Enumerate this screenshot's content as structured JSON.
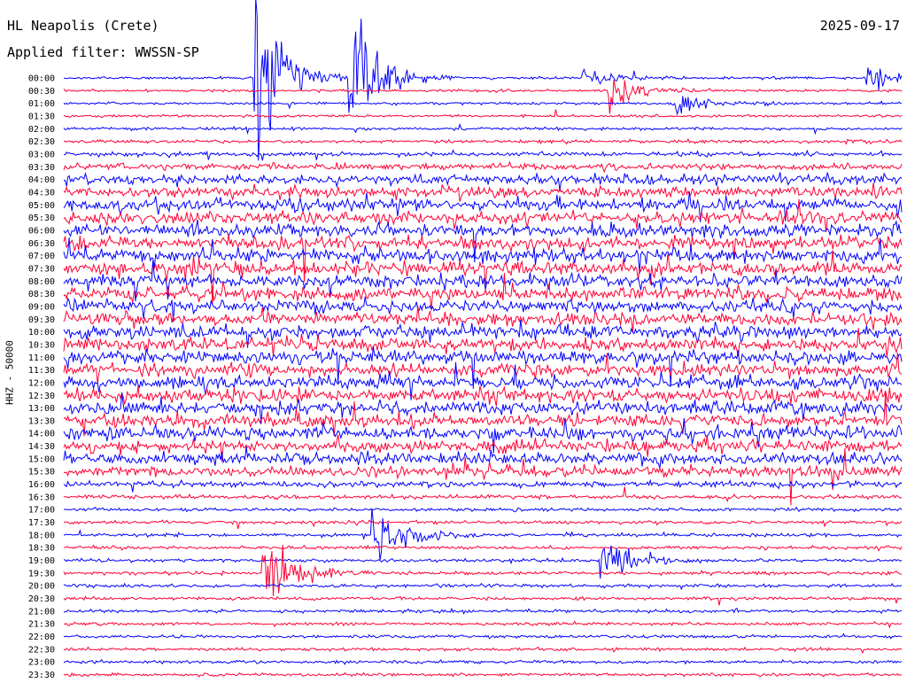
{
  "header": {
    "station": "HL Neapolis (Crete)",
    "filter": "Applied filter: WWSSN-SP",
    "date": "2025-09-17",
    "channel_label": "HHZ - 50000"
  },
  "chart_data": {
    "type": "line",
    "title": "HL Neapolis (Crete)",
    "subtitle": "Applied filter: WWSSN-SP",
    "date": "2025-09-17",
    "ylabel": "HHZ - 50000",
    "trace_colors": [
      "#0000ff",
      "#ff0033"
    ],
    "hours": [
      "00:00",
      "00:30",
      "01:00",
      "01:30",
      "02:00",
      "02:30",
      "03:00",
      "03:30",
      "04:00",
      "04:30",
      "05:00",
      "05:30",
      "06:00",
      "06:30",
      "07:00",
      "07:30",
      "08:00",
      "08:30",
      "09:00",
      "09:30",
      "10:00",
      "10:30",
      "11:00",
      "11:30",
      "12:00",
      "12:30",
      "13:00",
      "13:30",
      "14:00",
      "14:30",
      "15:00",
      "15:30",
      "16:00",
      "16:30",
      "17:00",
      "17:30",
      "18:00",
      "18:30",
      "19:00",
      "19:30",
      "20:00",
      "20:30",
      "21:00",
      "21:30",
      "22:00",
      "22:30",
      "23:00",
      "23:30"
    ],
    "relative_noise_amplitude": [
      1,
      1,
      1,
      1,
      1.1,
      1.3,
      1.8,
      2.6,
      3.6,
      4.2,
      4.6,
      4.8,
      5,
      5,
      5,
      5,
      5,
      5,
      5,
      5,
      5,
      5,
      5,
      5,
      5,
      5,
      5,
      5,
      4.9,
      4.7,
      4.4,
      3.6,
      2.2,
      1.5,
      1.3,
      1.3,
      1.3,
      1.3,
      1.3,
      1.3,
      1.3,
      1.3,
      1.3,
      1.2,
      1.2,
      1.2,
      1.2,
      1.2
    ],
    "events": [
      {
        "time": "00:00",
        "position_min": 6.8,
        "peak_amplitude": 120,
        "description": "large event, red trace clipped"
      },
      {
        "time": "00:00",
        "position_min": 10.2,
        "peak_amplitude": 90,
        "description": "large event, blue trace clipped"
      },
      {
        "time": "00:00",
        "position_min": 18.5,
        "peak_amplitude": 14
      },
      {
        "time": "00:00",
        "position_min": 28.7,
        "peak_amplitude": 18
      },
      {
        "time": "00:30",
        "position_min": 19.5,
        "peak_amplitude": 22
      },
      {
        "time": "01:00",
        "position_min": 21.9,
        "peak_amplitude": 20
      },
      {
        "time": "02:00",
        "position_min": 32.5,
        "peak_amplitude": 30
      },
      {
        "time": "18:00",
        "position_min": 11.0,
        "peak_amplitude": 40
      },
      {
        "time": "19:00",
        "position_min": 19.2,
        "peak_amplitude": 36
      },
      {
        "time": "19:30",
        "position_min": 7.1,
        "peak_amplitude": 60
      }
    ]
  }
}
